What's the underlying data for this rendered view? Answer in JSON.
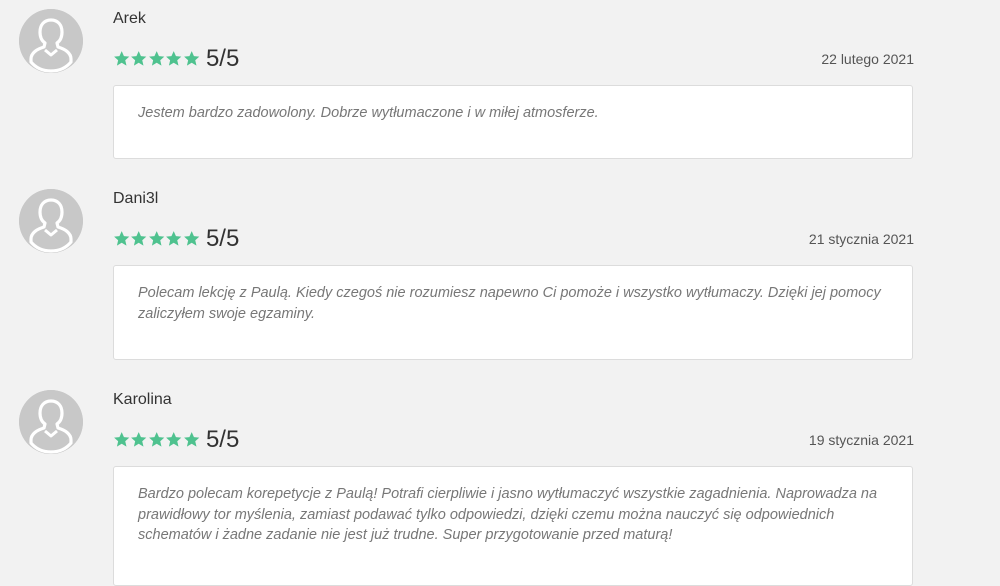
{
  "theme": {
    "star_color": "#4fc28f",
    "avatar_color": "#c8c8c8",
    "background": "#f2f2f2"
  },
  "reviews": [
    {
      "author": "Arek",
      "score": "5/5",
      "stars": 5,
      "date": "22 lutego 2021",
      "text": "Jestem bardzo zadowolony. Dobrze wytłumaczone i w miłej atmosferze."
    },
    {
      "author": "Dani3l",
      "score": "5/5",
      "stars": 5,
      "date": "21 stycznia 2021",
      "text": "Polecam lekcję z Paulą. Kiedy czegoś nie rozumiesz napewno Ci pomoże i wszystko wytłumaczy. Dzięki jej pomocy zaliczyłem swoje egzaminy."
    },
    {
      "author": "Karolina",
      "score": "5/5",
      "stars": 5,
      "date": "19 stycznia 2021",
      "text": "Bardzo polecam korepetycje z Paulą! Potrafi cierpliwie i jasno wytłumaczyć wszystkie zagadnienia. Naprowadza na prawidłowy tor myślenia, zamiast podawać tylko odpowiedzi, dzięki czemu można nauczyć się odpowiednich schematów i żadne zadanie nie jest już trudne. Super przygotowanie przed maturą!"
    }
  ]
}
